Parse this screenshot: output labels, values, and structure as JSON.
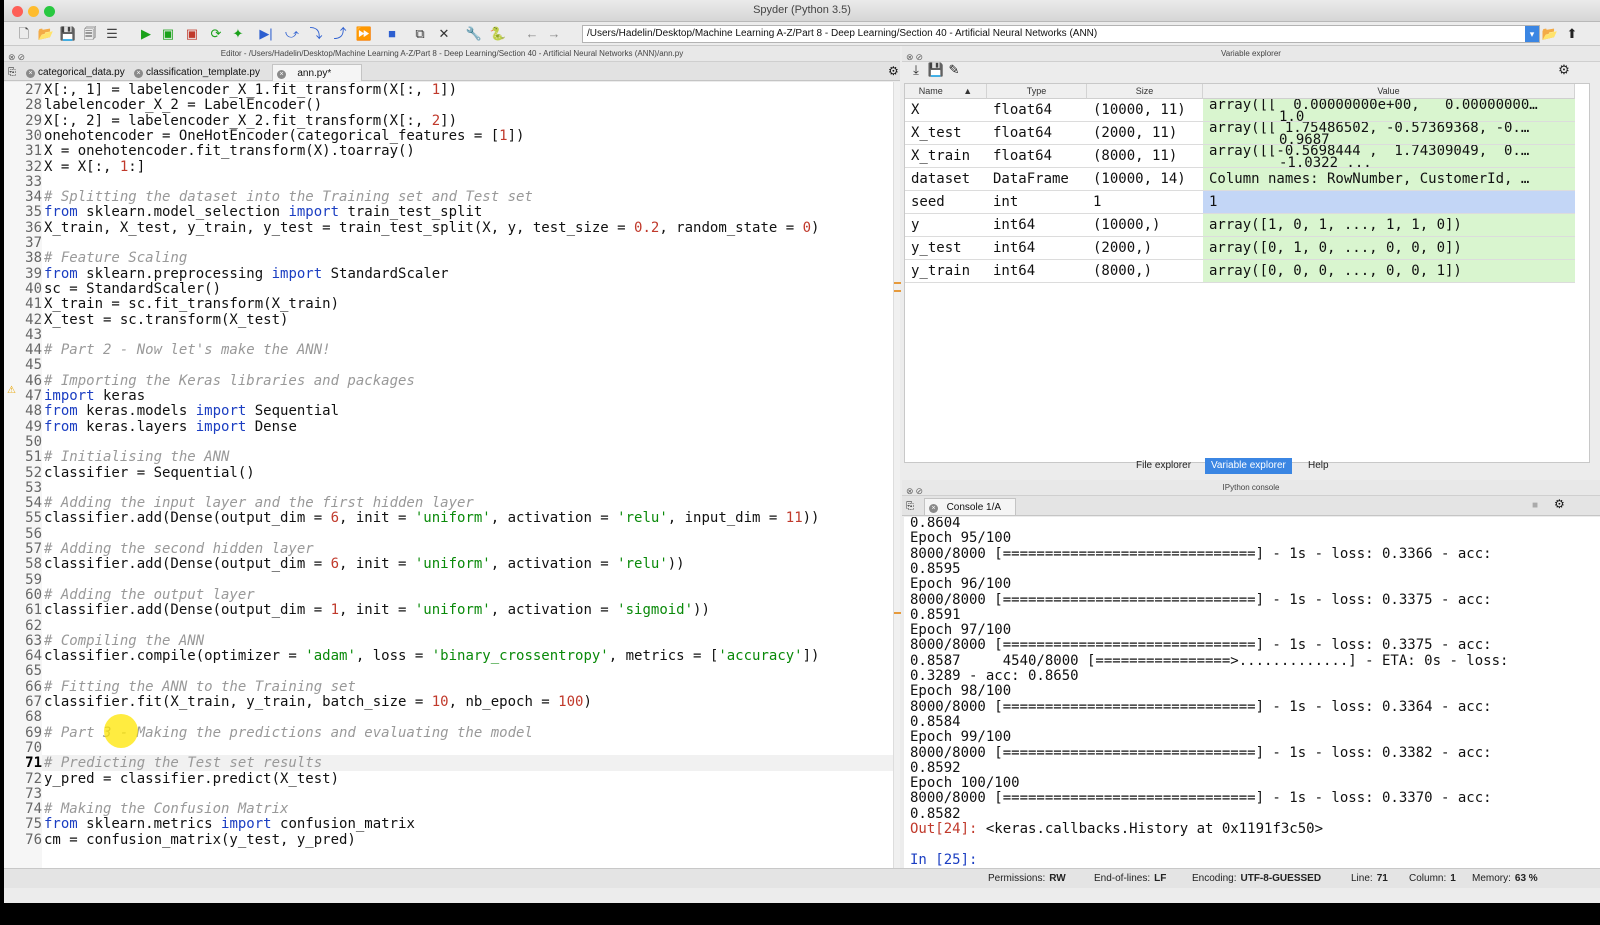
{
  "window": {
    "title": "Spyder (Python 3.5)",
    "close_color": "#fe5f57",
    "minimize_color": "#febc2e",
    "zoom_color": "#28c840"
  },
  "toolbar": {
    "path": "/Users/Hadelin/Desktop/Machine Learning A-Z/Part 8 - Deep Learning/Section 40 - Artificial Neural Networks (ANN)",
    "buttons": [
      {
        "icon": "new-file-icon",
        "glyph": "🗋",
        "color": "#444"
      },
      {
        "icon": "open-file-icon",
        "glyph": "📂",
        "color": "#444"
      },
      {
        "icon": "save-icon",
        "glyph": "💾",
        "color": "#444"
      },
      {
        "icon": "save-all-icon",
        "glyph": "🗐",
        "color": "#444"
      },
      {
        "icon": "outline-icon",
        "glyph": "☰",
        "color": "#444"
      },
      {
        "icon": "run-icon",
        "glyph": "▶",
        "color": "#1aa11a"
      },
      {
        "icon": "run-cell-icon",
        "glyph": "▣",
        "color": "#1aa11a"
      },
      {
        "icon": "run-cell-advance-icon",
        "glyph": "▣",
        "color": "#c0392b"
      },
      {
        "icon": "rerun-icon",
        "glyph": "⟳",
        "color": "#1aa11a"
      },
      {
        "icon": "run-selection-icon",
        "glyph": "✦",
        "color": "#1aa11a"
      },
      {
        "icon": "debug-icon",
        "glyph": "▶|",
        "color": "#2d5fd0"
      },
      {
        "icon": "step-icon",
        "glyph": "⤻",
        "color": "#2d5fd0"
      },
      {
        "icon": "step-into-icon",
        "glyph": "⤵",
        "color": "#2d5fd0"
      },
      {
        "icon": "step-return-icon",
        "glyph": "⤴",
        "color": "#2d5fd0"
      },
      {
        "icon": "continue-icon",
        "glyph": "⏩",
        "color": "#2d5fd0"
      },
      {
        "icon": "stop-debug-icon",
        "glyph": "■",
        "color": "#2d5fd0"
      },
      {
        "icon": "maximize-pane-icon",
        "glyph": "⧉",
        "color": "#333"
      },
      {
        "icon": "fullscreen-icon",
        "glyph": "✕",
        "color": "#333"
      },
      {
        "icon": "preferences-icon",
        "glyph": "🔧",
        "color": "#333"
      },
      {
        "icon": "python-path-icon",
        "glyph": "🐍",
        "color": "#3b6ea5"
      },
      {
        "icon": "back-arrow-icon",
        "glyph": "←",
        "color": "#888"
      },
      {
        "icon": "forward-arrow-icon",
        "glyph": "→",
        "color": "#888"
      }
    ]
  },
  "editor": {
    "pane_title": "Editor - /Users/Hadelin/Desktop/Machine Learning A-Z/Part 8 - Deep Learning/Section 40 - Artificial Neural Networks (ANN)/ann.py",
    "tabs": [
      "categorical_data.py",
      "classification_template.py",
      "ann.py*"
    ],
    "current_line": 71,
    "lines": [
      {
        "n": 27,
        "segs": [
          [
            "X[:, 1] = labelencoder_X_1.fit_transform(X[:, ",
            ""
          ],
          [
            "1",
            "nm"
          ],
          [
            "])",
            ""
          ]
        ]
      },
      {
        "n": 28,
        "segs": [
          [
            "labelencoder_X_2 = LabelEncoder()",
            ""
          ]
        ]
      },
      {
        "n": 29,
        "segs": [
          [
            "X[:, 2] = labelencoder_X_2.fit_transform(X[:, ",
            ""
          ],
          [
            "2",
            "nm"
          ],
          [
            "])",
            ""
          ]
        ]
      },
      {
        "n": 30,
        "segs": [
          [
            "onehotencoder = OneHotEncoder(categorical_features = [",
            ""
          ],
          [
            "1",
            "nm"
          ],
          [
            "])",
            ""
          ]
        ]
      },
      {
        "n": 31,
        "segs": [
          [
            "X = onehotencoder.fit_transform(X).toarray()",
            ""
          ]
        ]
      },
      {
        "n": 32,
        "segs": [
          [
            "X = X[:, ",
            ""
          ],
          [
            "1",
            "nm"
          ],
          [
            ":]",
            ""
          ]
        ]
      },
      {
        "n": 33,
        "segs": []
      },
      {
        "n": 34,
        "segs": [
          [
            "# Splitting the dataset into the Training set and Test set",
            "cm"
          ]
        ]
      },
      {
        "n": 35,
        "segs": [
          [
            "from",
            "kw"
          ],
          [
            " sklearn.model_selection ",
            ""
          ],
          [
            "import",
            "kw"
          ],
          [
            " train_test_split",
            ""
          ]
        ]
      },
      {
        "n": 36,
        "segs": [
          [
            "X_train, X_test, y_train, y_test = train_test_split(X, y, test_size = ",
            ""
          ],
          [
            "0.2",
            "nm"
          ],
          [
            ", random_state = ",
            ""
          ],
          [
            "0",
            "nm"
          ],
          [
            ")",
            ""
          ]
        ]
      },
      {
        "n": 37,
        "segs": []
      },
      {
        "n": 38,
        "segs": [
          [
            "# Feature Scaling",
            "cm"
          ]
        ]
      },
      {
        "n": 39,
        "segs": [
          [
            "from",
            "kw"
          ],
          [
            " sklearn.preprocessing ",
            ""
          ],
          [
            "import",
            "kw"
          ],
          [
            " StandardScaler",
            ""
          ]
        ]
      },
      {
        "n": 40,
        "segs": [
          [
            "sc = StandardScaler()",
            ""
          ]
        ]
      },
      {
        "n": 41,
        "segs": [
          [
            "X_train = sc.fit_transform(X_train)",
            ""
          ]
        ]
      },
      {
        "n": 42,
        "segs": [
          [
            "X_test = sc.transform(X_test)",
            ""
          ]
        ]
      },
      {
        "n": 43,
        "segs": []
      },
      {
        "n": 44,
        "segs": [
          [
            "# Part 2 - Now let's make the ANN!",
            "cm"
          ]
        ]
      },
      {
        "n": 45,
        "segs": []
      },
      {
        "n": 46,
        "segs": [
          [
            "# Importing the Keras libraries and packages",
            "cm"
          ]
        ]
      },
      {
        "n": 47,
        "segs": [
          [
            "import",
            "kw"
          ],
          [
            " keras",
            ""
          ]
        ]
      },
      {
        "n": 48,
        "segs": [
          [
            "from",
            "kw"
          ],
          [
            " keras.models ",
            ""
          ],
          [
            "import",
            "kw"
          ],
          [
            " Sequential",
            ""
          ]
        ]
      },
      {
        "n": 49,
        "segs": [
          [
            "from",
            "kw"
          ],
          [
            " keras.layers ",
            ""
          ],
          [
            "import",
            "kw"
          ],
          [
            " Dense",
            ""
          ]
        ]
      },
      {
        "n": 50,
        "segs": []
      },
      {
        "n": 51,
        "segs": [
          [
            "# Initialising the ANN",
            "cm"
          ]
        ]
      },
      {
        "n": 52,
        "segs": [
          [
            "classifier = Sequential()",
            ""
          ]
        ]
      },
      {
        "n": 53,
        "segs": []
      },
      {
        "n": 54,
        "segs": [
          [
            "# Adding the input layer and the first hidden layer",
            "cm"
          ]
        ]
      },
      {
        "n": 55,
        "segs": [
          [
            "classifier.add(Dense(output_dim = ",
            ""
          ],
          [
            "6",
            "nm"
          ],
          [
            ", init = ",
            ""
          ],
          [
            "'uniform'",
            "st"
          ],
          [
            ", activation = ",
            ""
          ],
          [
            "'relu'",
            "st"
          ],
          [
            ", input_dim = ",
            ""
          ],
          [
            "11",
            "nm"
          ],
          [
            "))",
            ""
          ]
        ]
      },
      {
        "n": 56,
        "segs": []
      },
      {
        "n": 57,
        "segs": [
          [
            "# Adding the second hidden layer",
            "cm"
          ]
        ]
      },
      {
        "n": 58,
        "segs": [
          [
            "classifier.add(Dense(output_dim = ",
            ""
          ],
          [
            "6",
            "nm"
          ],
          [
            ", init = ",
            ""
          ],
          [
            "'uniform'",
            "st"
          ],
          [
            ", activation = ",
            ""
          ],
          [
            "'relu'",
            "st"
          ],
          [
            "))",
            ""
          ]
        ]
      },
      {
        "n": 59,
        "segs": []
      },
      {
        "n": 60,
        "segs": [
          [
            "# Adding the output layer",
            "cm"
          ]
        ]
      },
      {
        "n": 61,
        "segs": [
          [
            "classifier.add(Dense(output_dim = ",
            ""
          ],
          [
            "1",
            "nm"
          ],
          [
            ", init = ",
            ""
          ],
          [
            "'uniform'",
            "st"
          ],
          [
            ", activation = ",
            ""
          ],
          [
            "'sigmoid'",
            "st"
          ],
          [
            "))",
            ""
          ]
        ]
      },
      {
        "n": 62,
        "segs": []
      },
      {
        "n": 63,
        "segs": [
          [
            "# Compiling the ANN",
            "cm"
          ]
        ]
      },
      {
        "n": 64,
        "segs": [
          [
            "classifier.compile(optimizer = ",
            ""
          ],
          [
            "'adam'",
            "st"
          ],
          [
            ", loss = ",
            ""
          ],
          [
            "'binary_crossentropy'",
            "st"
          ],
          [
            ", metrics = [",
            ""
          ],
          [
            "'accuracy'",
            "st"
          ],
          [
            "])",
            ""
          ]
        ]
      },
      {
        "n": 65,
        "segs": []
      },
      {
        "n": 66,
        "segs": [
          [
            "# Fitting the ANN to the Training set",
            "cm"
          ]
        ]
      },
      {
        "n": 67,
        "segs": [
          [
            "classifier.fit(X_train, y_train, batch_size = ",
            ""
          ],
          [
            "10",
            "nm"
          ],
          [
            ", nb_epoch = ",
            ""
          ],
          [
            "100",
            "nm"
          ],
          [
            ")",
            ""
          ]
        ]
      },
      {
        "n": 68,
        "segs": []
      },
      {
        "n": 69,
        "segs": [
          [
            "# Part 3 - Making the predictions and evaluating the model",
            "cm"
          ]
        ]
      },
      {
        "n": 70,
        "segs": []
      },
      {
        "n": 71,
        "segs": [
          [
            "# Predicting the Test set results",
            "cm"
          ]
        ]
      },
      {
        "n": 72,
        "segs": [
          [
            "y_pred = classifier.predict(X_test)",
            ""
          ]
        ]
      },
      {
        "n": 73,
        "segs": []
      },
      {
        "n": 74,
        "segs": [
          [
            "# Making the Confusion Matrix",
            "cm"
          ]
        ]
      },
      {
        "n": 75,
        "segs": [
          [
            "from",
            "kw"
          ],
          [
            " sklearn.metrics ",
            ""
          ],
          [
            "import",
            "kw"
          ],
          [
            " confusion_matrix",
            ""
          ]
        ]
      },
      {
        "n": 76,
        "segs": [
          [
            "cm = confusion_matrix(y_test, y_pred)",
            ""
          ]
        ]
      }
    ]
  },
  "variable_explorer": {
    "pane_title": "Variable explorer",
    "headers": [
      "Name",
      "Type",
      "Size",
      "Value"
    ],
    "rows": [
      {
        "name": "X",
        "type": "float64",
        "size": "(10000, 11)",
        "value": "array([[  0.00000000e+00,   0.00000000…",
        "value2": "1.0"
      },
      {
        "name": "X_test",
        "type": "float64",
        "size": "(2000, 11)",
        "value": "array([[ 1.75486502, -0.57369368, -0.…",
        "value2": "0.9687"
      },
      {
        "name": "X_train",
        "type": "float64",
        "size": "(8000, 11)",
        "value": "array([[-0.5698444 ,  1.74309049,  0.…",
        "value2": "-1.0322 ..."
      },
      {
        "name": "dataset",
        "type": "DataFrame",
        "size": "(10000, 14)",
        "value": "Column names: RowNumber, CustomerId, …",
        "value2": ""
      },
      {
        "name": "seed",
        "type": "int",
        "size": "1",
        "value": "1",
        "value2": ""
      },
      {
        "name": "y",
        "type": "int64",
        "size": "(10000,)",
        "value": "array([1, 0, 1, ..., 1, 1, 0])",
        "value2": ""
      },
      {
        "name": "y_test",
        "type": "int64",
        "size": "(2000,)",
        "value": "array([0, 1, 0, ..., 0, 0, 0])",
        "value2": ""
      },
      {
        "name": "y_train",
        "type": "int64",
        "size": "(8000,)",
        "value": "array([0, 0, 0, ..., 0, 0, 1])",
        "value2": ""
      }
    ],
    "bottom_tabs": [
      "File explorer",
      "Variable explorer",
      "Help"
    ],
    "active_tab": "Variable explorer",
    "selected_row": "seed"
  },
  "console": {
    "pane_title": "IPython console",
    "tab": "Console 1/A",
    "lines": [
      [
        [
          "0.8604",
          ""
        ]
      ],
      [
        [
          "Epoch 95/100",
          ""
        ]
      ],
      [
        [
          "8000/8000 [==============================] - 1s - loss: 0.3366 - acc:",
          ""
        ]
      ],
      [
        [
          "0.8595",
          ""
        ]
      ],
      [
        [
          "Epoch 96/100",
          ""
        ]
      ],
      [
        [
          "8000/8000 [==============================] - 1s - loss: 0.3375 - acc:",
          ""
        ]
      ],
      [
        [
          "0.8591",
          ""
        ]
      ],
      [
        [
          "Epoch 97/100",
          ""
        ]
      ],
      [
        [
          "8000/8000 [==============================] - 1s - loss: 0.3375 - acc:",
          ""
        ]
      ],
      [
        [
          "0.8587     4540/8000 [================>.............] - ETA: 0s - loss:",
          ""
        ]
      ],
      [
        [
          "0.3289 - acc: 0.8650",
          ""
        ]
      ],
      [
        [
          "Epoch 98/100",
          ""
        ]
      ],
      [
        [
          "8000/8000 [==============================] - 1s - loss: 0.3364 - acc:",
          ""
        ]
      ],
      [
        [
          "0.8584",
          ""
        ]
      ],
      [
        [
          "Epoch 99/100",
          ""
        ]
      ],
      [
        [
          "8000/8000 [==============================] - 1s - loss: 0.3382 - acc:",
          ""
        ]
      ],
      [
        [
          "0.8592",
          ""
        ]
      ],
      [
        [
          "Epoch 100/100",
          ""
        ]
      ],
      [
        [
          "8000/8000 [==============================] - 1s - loss: 0.3370 - acc:",
          ""
        ]
      ],
      [
        [
          "0.8582",
          ""
        ]
      ],
      [
        [
          "Out[",
          "out"
        ],
        [
          "24",
          "out"
        ],
        [
          "]: ",
          "out"
        ],
        [
          "<keras.callbacks.History at 0x1191f3c50>",
          ""
        ]
      ],
      [
        [
          "",
          ""
        ]
      ],
      [
        [
          "In [",
          "prompt"
        ],
        [
          "25",
          "prompt"
        ],
        [
          "]:",
          "prompt"
        ]
      ]
    ]
  },
  "statusbar": {
    "permissions_label": "Permissions:",
    "permissions": "RW",
    "eol_label": "End-of-lines:",
    "eol": "LF",
    "encoding_label": "Encoding:",
    "encoding": "UTF-8-GUESSED",
    "line_label": "Line:",
    "line": "71",
    "column_label": "Column:",
    "column": "1",
    "memory_label": "Memory:",
    "memory": "63 %"
  }
}
